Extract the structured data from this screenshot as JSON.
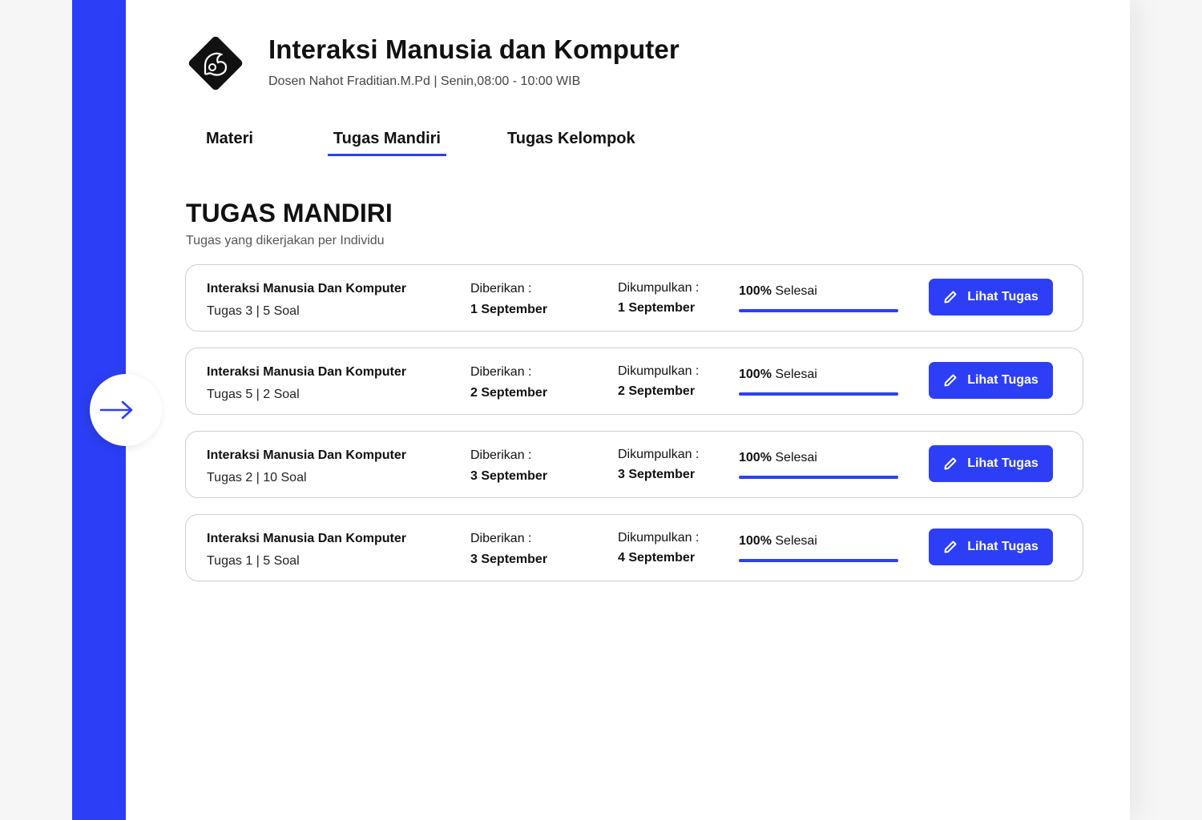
{
  "course": {
    "title": "Interaksi Manusia dan Komputer",
    "subtitle": "Dosen Nahot Fraditian.M.Pd | Senin,08:00 - 10:00 WIB"
  },
  "tabs": [
    {
      "label": "Materi",
      "active": false
    },
    {
      "label": "Tugas Mandiri",
      "active": true
    },
    {
      "label": "Tugas Kelompok",
      "active": false
    }
  ],
  "section": {
    "title": "TUGAS MANDIRI",
    "subtitle": "Tugas yang dikerjakan per Individu"
  },
  "labels": {
    "given": "Diberikan :",
    "submitted": "Dikumpulkan :",
    "done": "Selesai",
    "view_button": "Lihat Tugas"
  },
  "tasks": [
    {
      "name": "Interaksi Manusia Dan Komputer",
      "meta": "Tugas 3 | 5 Soal",
      "given": "1 September",
      "submitted": "1 September",
      "progress": "100%",
      "progress_value": 100
    },
    {
      "name": "Interaksi Manusia Dan Komputer",
      "meta": "Tugas 5 | 2 Soal",
      "given": "2 September",
      "submitted": "2 September",
      "progress": "100%",
      "progress_value": 100
    },
    {
      "name": "Interaksi Manusia Dan Komputer",
      "meta": "Tugas 2 | 10 Soal",
      "given": "3 September",
      "submitted": "3 September",
      "progress": "100%",
      "progress_value": 100
    },
    {
      "name": "Interaksi Manusia Dan Komputer",
      "meta": "Tugas 1 | 5 Soal",
      "given": "3 September",
      "submitted": "4 September",
      "progress": "100%",
      "progress_value": 100
    }
  ],
  "colors": {
    "accent": "#2c3ff6",
    "card_border": "#cfcfcf"
  }
}
